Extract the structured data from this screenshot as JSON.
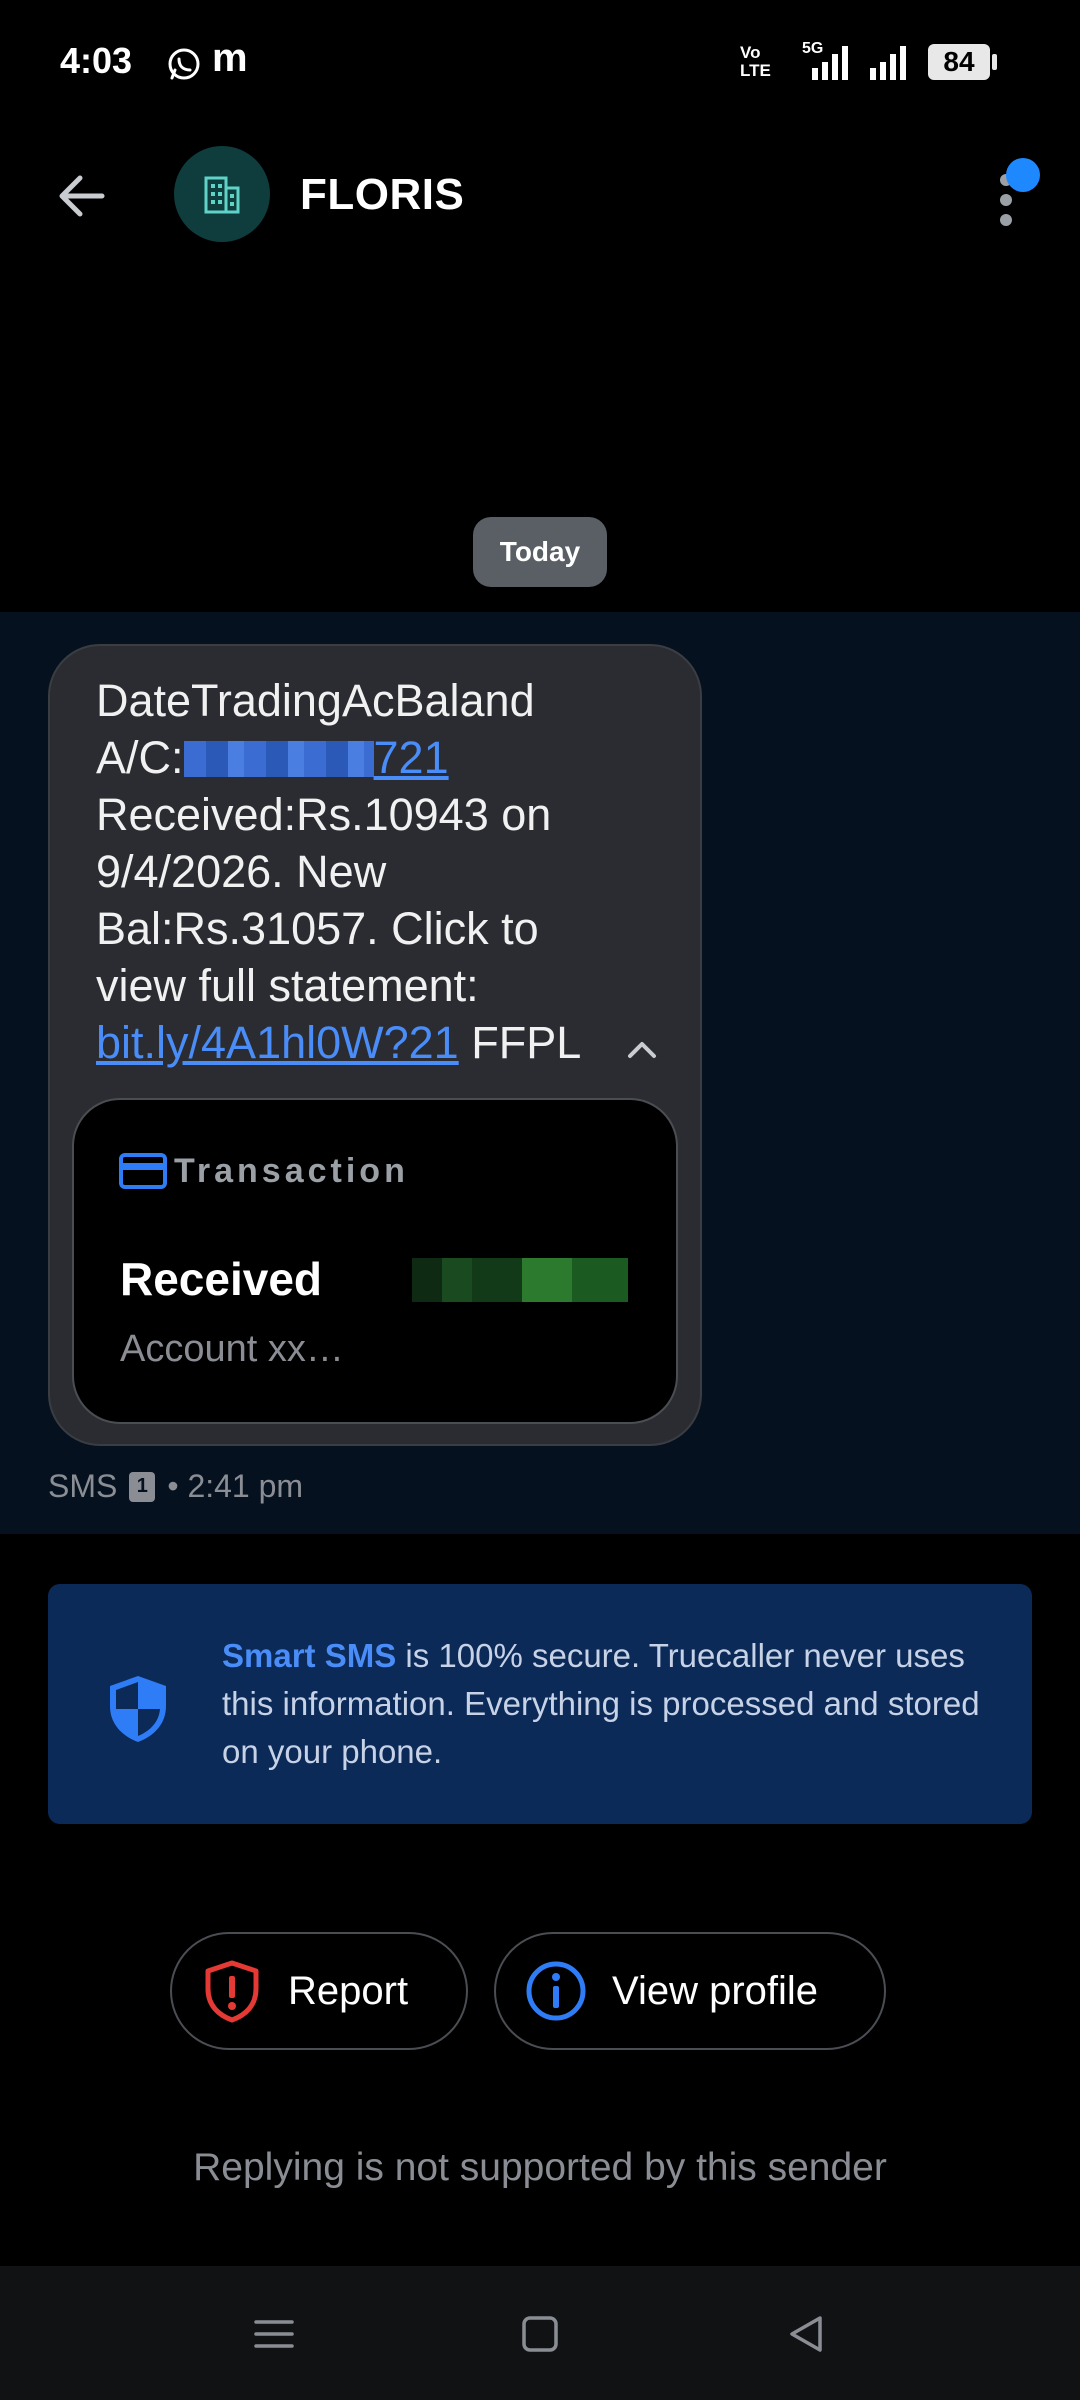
{
  "status_bar": {
    "time": "4:03",
    "carrier_label": "m",
    "battery": "84",
    "network_lines": [
      "Vo",
      "LTE"
    ],
    "network_type": "5G"
  },
  "header": {
    "sender_name": "FLORIS"
  },
  "date_chip": "Today",
  "message": {
    "line1": "DateTradingAcBaland",
    "account_prefix": "A/C:",
    "account_suffix": "721",
    "line3": "Received:Rs.10943 on",
    "line4": "9/4/2026. New",
    "line5": "Bal:Rs.31057. Click to",
    "line6": "view full statement:",
    "link": "bit.ly/4A1hl0W?21",
    "trailer": "FFPL",
    "meta_type": "SMS",
    "sim": "1",
    "meta_time": "• 2:41 pm"
  },
  "transaction_card": {
    "title": "Transaction",
    "status": "Received",
    "account": "Account xx…"
  },
  "info": {
    "brand": "Smart SMS",
    "text": "is 100% secure. Truecaller never uses this information. Everything is processed and stored on your phone."
  },
  "actions": {
    "report": "Report",
    "view_profile": "View profile"
  },
  "reply_note": "Replying is not supported by this sender",
  "icons": {
    "back": "back-arrow-icon",
    "building": "building-icon",
    "menu": "more-vertical-icon",
    "card": "credit-card-icon",
    "shield": "shield-icon",
    "report": "report-shield-icon",
    "info": "info-icon"
  },
  "colors": {
    "accent": "#4a8df8",
    "info_bg": "#0b2a58",
    "report_red": "#e53935",
    "avatar_bg": "#0f3c3c"
  }
}
